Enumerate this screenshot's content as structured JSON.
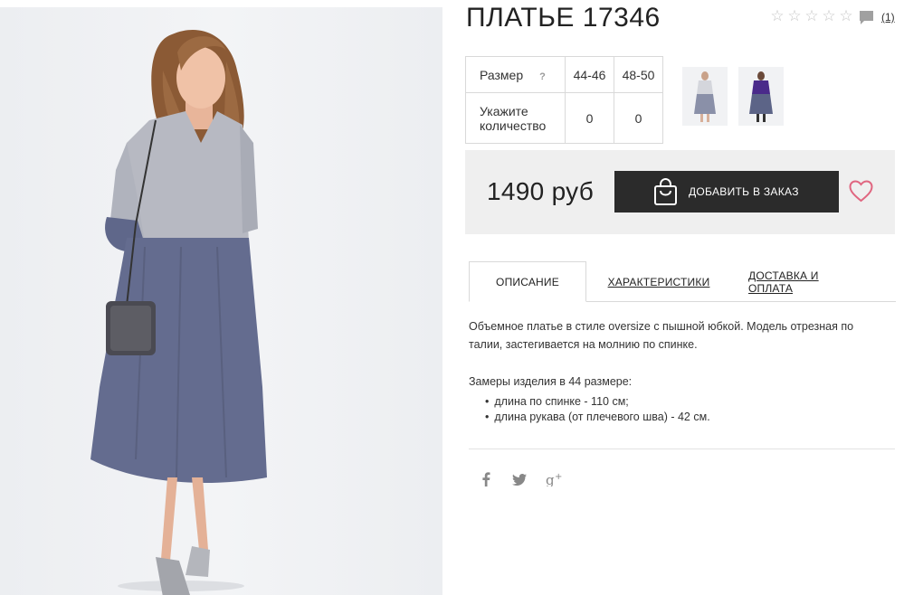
{
  "product": {
    "title": "ПЛАТЬЕ 17346",
    "rating": {
      "stars_filled": 0,
      "stars_total": 5,
      "review_count": "(1)"
    }
  },
  "sizes_table": {
    "size_label": "Размер",
    "help_mark": "?",
    "qty_label": "Укажите количество",
    "sizes": [
      "44-46",
      "48-50"
    ],
    "quantities": [
      "0",
      "0"
    ]
  },
  "thumbnails": [
    {
      "name": "thumb-front-light"
    },
    {
      "name": "thumb-front-purple"
    }
  ],
  "buy": {
    "price": "1490 руб",
    "add_button_label": "ДОБАВИТЬ В ЗАКАЗ"
  },
  "tabs": [
    {
      "label": "ОПИСАНИЕ",
      "active": true
    },
    {
      "label": "ХАРАКТЕРИСТИКИ",
      "active": false
    },
    {
      "label": "ДОСТАВКА И ОПЛАТА",
      "active": false
    }
  ],
  "description": {
    "text": "Объемное платье в стиле oversize с пышной юбкой. Модель отрезная по талии, застегивается на молнию по спинке.",
    "measure_title": "Замеры изделия в 44 размере:",
    "measures": [
      "длина по спинке - 110 см;",
      "длина рукава (от плечевого шва) - 42 см."
    ]
  },
  "social": [
    "facebook-icon",
    "twitter-icon",
    "google-plus-icon"
  ],
  "colors": {
    "button_bg": "#2b2b2b",
    "buybox_bg": "#efefef",
    "heart": "#e06680",
    "dress_top": "#b7b9c2",
    "dress_skirt": "#646c8f"
  }
}
